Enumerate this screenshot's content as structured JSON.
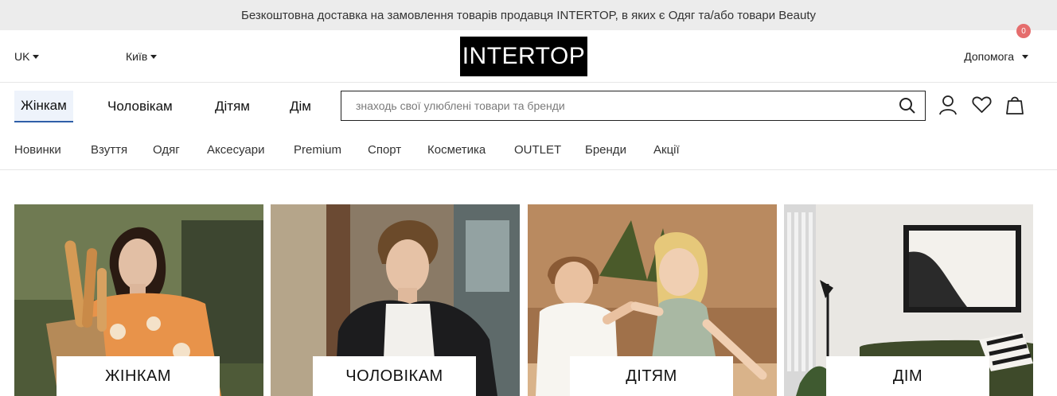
{
  "promo": {
    "text": "Безкоштовна доставка на замовлення товарів продавця INTERTOP, в яких є Одяг та/або товари Beauty"
  },
  "header": {
    "language": "UK",
    "city": "Київ",
    "logo": "INTERTOP",
    "help": "Допомога"
  },
  "gender_tabs": [
    {
      "label": "Жінкам",
      "active": true
    },
    {
      "label": "Чоловікам",
      "active": false
    },
    {
      "label": "Дітям",
      "active": false
    },
    {
      "label": "Дім",
      "active": false
    }
  ],
  "search": {
    "placeholder": "знаходь свої улюблені товари та бренди",
    "value": ""
  },
  "icons": {
    "search": "search-icon",
    "account": "user-icon",
    "wishlist": "heart-icon",
    "cart": "shopping-bag-icon"
  },
  "cart": {
    "count": "0"
  },
  "categories": [
    "Новинки",
    "Взуття",
    "Одяг",
    "Аксесуари",
    "Premium",
    "Спорт",
    "Косметика",
    "OUTLET",
    "Бренди",
    "Акції"
  ],
  "cards": [
    {
      "label": "ЖІНКАМ",
      "image": "woman-with-bread-photo"
    },
    {
      "label": "ЧОЛОВІКАМ",
      "image": "man-in-jacket-photo"
    },
    {
      "label": "ДІТЯМ",
      "image": "children-holding-hands-photo"
    },
    {
      "label": "ДІМ",
      "image": "home-interior-photo"
    }
  ],
  "colors": {
    "promo_bg": "#ececec",
    "logo_bg": "#000000",
    "active_tab_bg": "#eef3fb",
    "active_tab_underline": "#2f5fa8",
    "cart_badge": "#e56d6d"
  }
}
